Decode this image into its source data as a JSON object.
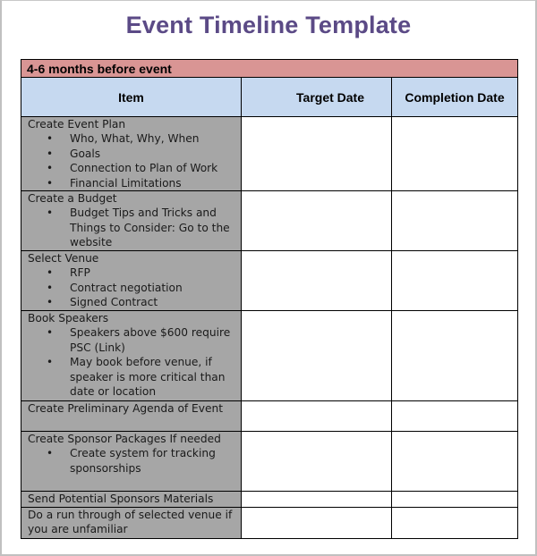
{
  "document": {
    "title": "Event Timeline Template",
    "section_label": "4-6 months before event",
    "columns": [
      "Item",
      "Target Date",
      "Completion Date"
    ],
    "rows": [
      {
        "item": "Create Event Plan",
        "bullets": [
          "Who, What, Why, When",
          "Goals",
          "Connection to Plan of Work",
          "Financial Limitations"
        ],
        "target_date": "",
        "completion_date": ""
      },
      {
        "item": "Create a Budget",
        "bullets": [
          "Budget Tips and Tricks and Things to Consider: Go to the website"
        ],
        "target_date": "",
        "completion_date": ""
      },
      {
        "item": "Select Venue",
        "bullets": [
          "RFP",
          "Contract negotiation",
          "Signed Contract"
        ],
        "target_date": "",
        "completion_date": ""
      },
      {
        "item": "Book Speakers",
        "bullets": [
          "Speakers above $600 require PSC (Link)",
          "May book before venue, if speaker is more critical than date or location"
        ],
        "target_date": "",
        "completion_date": ""
      },
      {
        "item": "Create Preliminary Agenda  of Event",
        "bullets": [],
        "target_date": "",
        "completion_date": ""
      },
      {
        "item": "Create Sponsor Packages If needed",
        "bullets": [
          "Create system for tracking sponsorships"
        ],
        "target_date": "",
        "completion_date": ""
      },
      {
        "item": "Send Potential Sponsors Materials",
        "bullets": [],
        "target_date": "",
        "completion_date": ""
      },
      {
        "item": "Do a run through of selected  venue if you are unfamiliar",
        "bullets": [],
        "target_date": "",
        "completion_date": ""
      }
    ],
    "colors": {
      "title": "#5b4a86",
      "section_bg": "#d99594",
      "header_bg": "#c6d9f0",
      "item_bg": "#a6a6a6"
    }
  }
}
